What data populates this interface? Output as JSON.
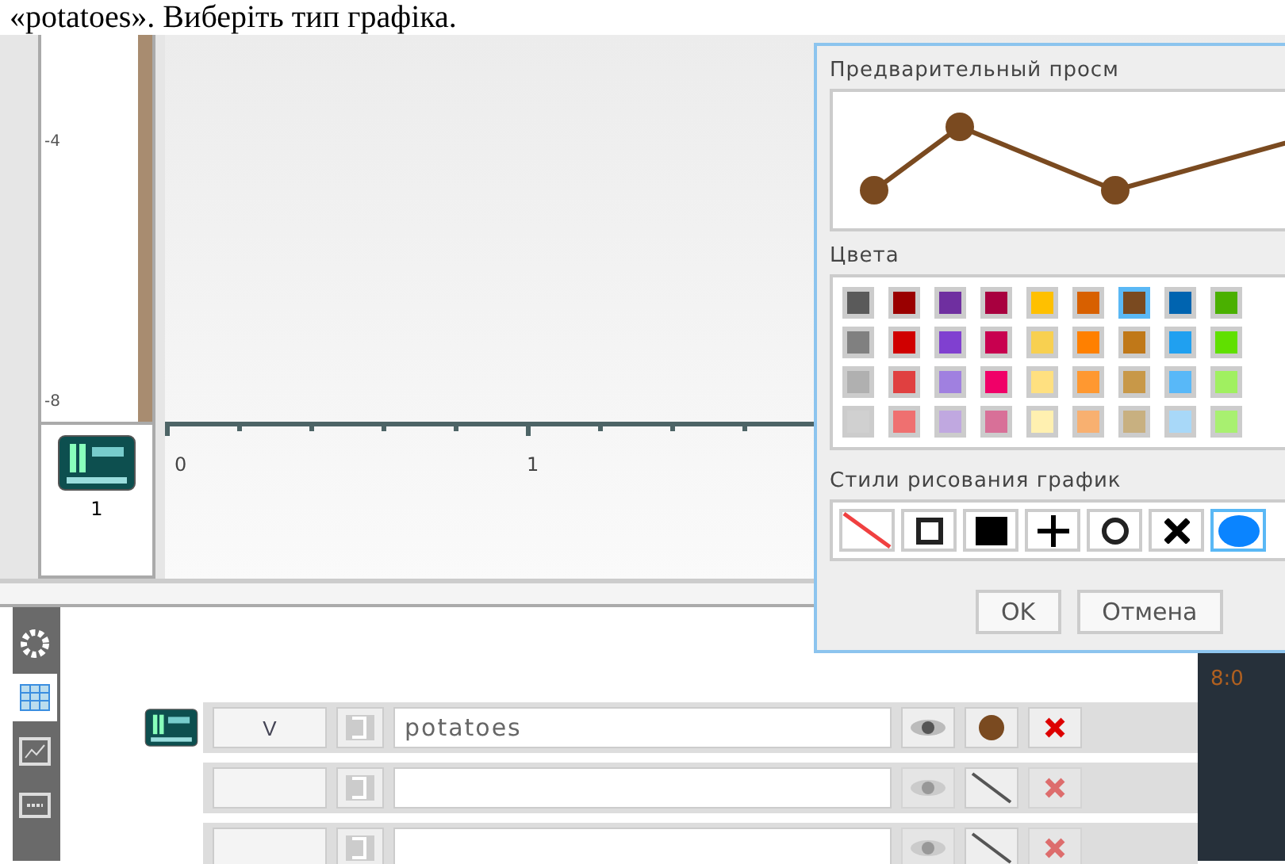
{
  "caption": "«potatoes». Виберіть тип графіка.",
  "graph": {
    "y_ticks": [
      "-4",
      "-8"
    ],
    "x_ticks": [
      "0",
      "1"
    ],
    "sensor_label": "1"
  },
  "toolbar": [
    {
      "kind": "settings",
      "selected": false
    },
    {
      "kind": "table",
      "selected": true
    },
    {
      "kind": "graph",
      "selected": false
    },
    {
      "kind": "meter",
      "selected": false
    }
  ],
  "rows": [
    {
      "sensor": true,
      "unit": "V",
      "name": "potatoes",
      "marker": {
        "kind": "dot"
      },
      "disabled": false
    },
    {
      "sensor": false,
      "unit": "",
      "name": "",
      "marker": {
        "kind": "line"
      },
      "disabled": true
    },
    {
      "sensor": false,
      "unit": "",
      "name": "",
      "marker": {
        "kind": "line"
      },
      "disabled": true
    }
  ],
  "meter_reading": "8:0",
  "dialog": {
    "preview_title": "Предварительный просм",
    "colors_title": "Цвета",
    "colors": [
      [
        {
          "color": "#5a5a5a",
          "selected": false
        },
        {
          "color": "#9a0000",
          "selected": false
        },
        {
          "color": "#6f2fa0",
          "selected": false
        },
        {
          "color": "#a8003f",
          "selected": false
        },
        {
          "color": "#ffc000",
          "selected": false
        },
        {
          "color": "#d86000",
          "selected": false
        },
        {
          "color": "#7a4a20",
          "selected": true
        },
        {
          "color": "#0064b0",
          "selected": false
        },
        {
          "color": "#4ab000",
          "selected": false
        }
      ],
      [
        {
          "color": "#808080",
          "selected": false
        },
        {
          "color": "#d00000",
          "selected": false
        },
        {
          "color": "#8040d0",
          "selected": false
        },
        {
          "color": "#c8004f",
          "selected": false
        },
        {
          "color": "#f8d050",
          "selected": false
        },
        {
          "color": "#ff8000",
          "selected": false
        },
        {
          "color": "#c07818",
          "selected": false
        },
        {
          "color": "#20a0f0",
          "selected": false
        },
        {
          "color": "#60e000",
          "selected": false
        }
      ],
      [
        {
          "color": "#b0b0b0",
          "selected": false
        },
        {
          "color": "#e04040",
          "selected": false
        },
        {
          "color": "#a080e0",
          "selected": false
        },
        {
          "color": "#f00068",
          "selected": false
        },
        {
          "color": "#ffe080",
          "selected": false
        },
        {
          "color": "#ff9830",
          "selected": false
        },
        {
          "color": "#c89848",
          "selected": false
        },
        {
          "color": "#58b8f8",
          "selected": false
        },
        {
          "color": "#a0f060",
          "selected": false
        }
      ],
      [
        {
          "color": "#d0d0d0",
          "selected": false
        },
        {
          "color": "#ef7070",
          "selected": false
        },
        {
          "color": "#c0a8e0",
          "selected": false
        },
        {
          "color": "#d87098",
          "selected": false
        },
        {
          "color": "#fff0b0",
          "selected": false
        },
        {
          "color": "#f8b070",
          "selected": false
        },
        {
          "color": "#c8b080",
          "selected": false
        },
        {
          "color": "#a8d8f8",
          "selected": false
        },
        {
          "color": "#a8f070",
          "selected": false
        }
      ]
    ],
    "styles_title": "Стили рисования график",
    "styles": [
      {
        "kind": "line",
        "selected": false
      },
      {
        "kind": "square",
        "selected": false
      },
      {
        "kind": "filled-square",
        "selected": false
      },
      {
        "kind": "plus",
        "selected": false
      },
      {
        "kind": "circle",
        "selected": false
      },
      {
        "kind": "cross",
        "selected": false
      },
      {
        "kind": "dot",
        "selected": true
      }
    ],
    "buttons": [
      "OK",
      "Отмена"
    ]
  }
}
